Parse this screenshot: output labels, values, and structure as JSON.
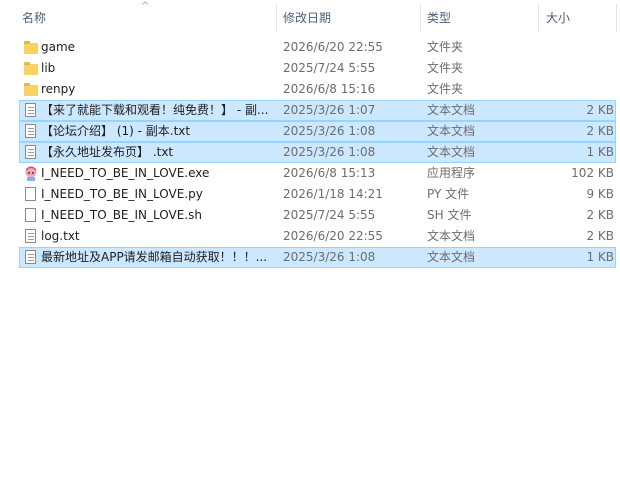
{
  "header": {
    "name": "名称",
    "date": "修改日期",
    "type": "类型",
    "size": "大小",
    "sort_indicator": "^"
  },
  "files": [
    {
      "name": "game",
      "date": "2026/6/20 22:55",
      "type": "文件夹",
      "size": "",
      "icon": "folder-icon",
      "selected": false
    },
    {
      "name": "lib",
      "date": "2025/7/24 5:55",
      "type": "文件夹",
      "size": "",
      "icon": "folder-icon",
      "selected": false
    },
    {
      "name": "renpy",
      "date": "2026/6/8 15:16",
      "type": "文件夹",
      "size": "",
      "icon": "folder-icon",
      "selected": false
    },
    {
      "name": "【来了就能下载和观看！纯免费！】 - 副...",
      "date": "2025/3/26 1:07",
      "type": "文本文档",
      "size": "2 KB",
      "icon": "text-file-icon",
      "selected": true
    },
    {
      "name": "【论坛介绍】 (1) - 副本.txt",
      "date": "2025/3/26 1:08",
      "type": "文本文档",
      "size": "2 KB",
      "icon": "text-file-icon",
      "selected": true
    },
    {
      "name": "【永久地址发布页】 .txt",
      "date": "2025/3/26 1:08",
      "type": "文本文档",
      "size": "1 KB",
      "icon": "text-file-icon",
      "selected": true
    },
    {
      "name": "I_NEED_TO_BE_IN_LOVE.exe",
      "date": "2026/6/8 15:13",
      "type": "应用程序",
      "size": "102 KB",
      "icon": "app-icon",
      "selected": false
    },
    {
      "name": "I_NEED_TO_BE_IN_LOVE.py",
      "date": "2026/1/18 14:21",
      "type": "PY 文件",
      "size": "9 KB",
      "icon": "file-icon",
      "selected": false
    },
    {
      "name": "I_NEED_TO_BE_IN_LOVE.sh",
      "date": "2025/7/24 5:55",
      "type": "SH 文件",
      "size": "2 KB",
      "icon": "file-icon",
      "selected": false
    },
    {
      "name": "log.txt",
      "date": "2026/6/20 22:55",
      "type": "文本文档",
      "size": "2 KB",
      "icon": "text-file-icon",
      "selected": false
    },
    {
      "name": "最新地址及APP请发邮箱自动获取！！！...",
      "date": "2025/3/26 1:08",
      "type": "文本文档",
      "size": "1 KB",
      "icon": "text-file-icon",
      "selected": true
    }
  ],
  "colors": {
    "selection_bg": "#cce8ff",
    "selection_border": "#99d1ff",
    "header_text": "#4c607a",
    "folder": "#f7d266"
  }
}
